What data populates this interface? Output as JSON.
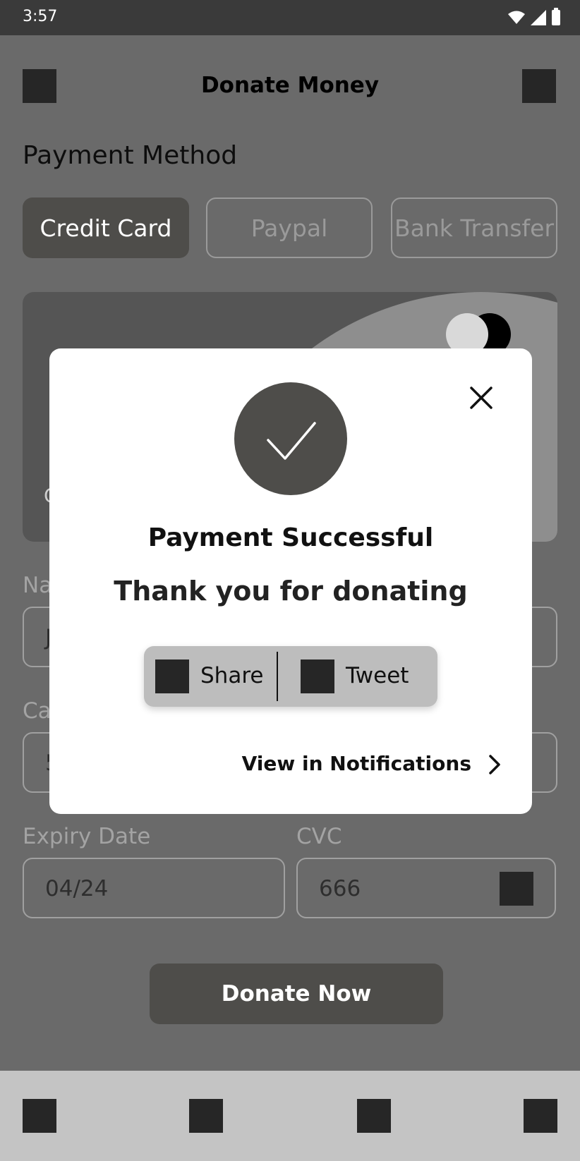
{
  "status_bar": {
    "time": "3:57"
  },
  "header": {
    "title": "Donate Money"
  },
  "payment": {
    "section_title": "Payment Method",
    "methods": [
      {
        "label": "Credit Card",
        "selected": true
      },
      {
        "label": "Paypal",
        "selected": false
      },
      {
        "label": "Bank Transfer",
        "selected": false
      }
    ],
    "card_fragment": "C"
  },
  "form": {
    "name_label_partial": "Na",
    "name_value_partial": "J",
    "card_label_partial": "Ca",
    "card_value_partial": "5",
    "expiry_label": "Expiry Date",
    "expiry_value": "04/24",
    "cvc_label": "CVC",
    "cvc_value": "666"
  },
  "donate_button": "Donate Now",
  "modal": {
    "title": "Payment Successful",
    "subtitle": "Thank you for donating",
    "share_label": "Share",
    "tweet_label": "Tweet",
    "notifications_link": "View in Notifications"
  },
  "colors": {
    "primary": "#4e4d4a",
    "overlay": "#6a6a6a",
    "nav_background": "#c4c4c4"
  }
}
